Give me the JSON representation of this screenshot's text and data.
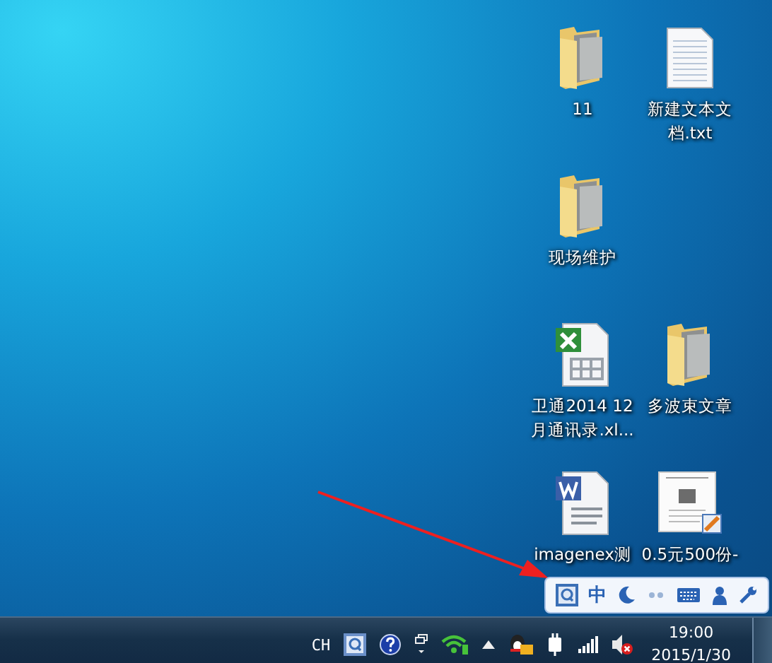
{
  "desktop_icons": [
    {
      "kind": "folder",
      "label": "11"
    },
    {
      "kind": "text-file",
      "label": "新建文本文档.txt"
    },
    {
      "kind": "folder",
      "label": "现场维护"
    },
    {
      "kind": "excel-file",
      "label": "卫通2014 12月通讯录.xl..."
    },
    {
      "kind": "folder",
      "label": "多波束文章"
    },
    {
      "kind": "word-file",
      "label": "imagenex测"
    },
    {
      "kind": "image-file",
      "label": "0.5元500份-"
    }
  ],
  "ime_toolbar": {
    "mode": "中"
  },
  "taskbar": {
    "language": "CH",
    "volume_muted": true,
    "time": "19:00",
    "date": "2015/1/30"
  }
}
